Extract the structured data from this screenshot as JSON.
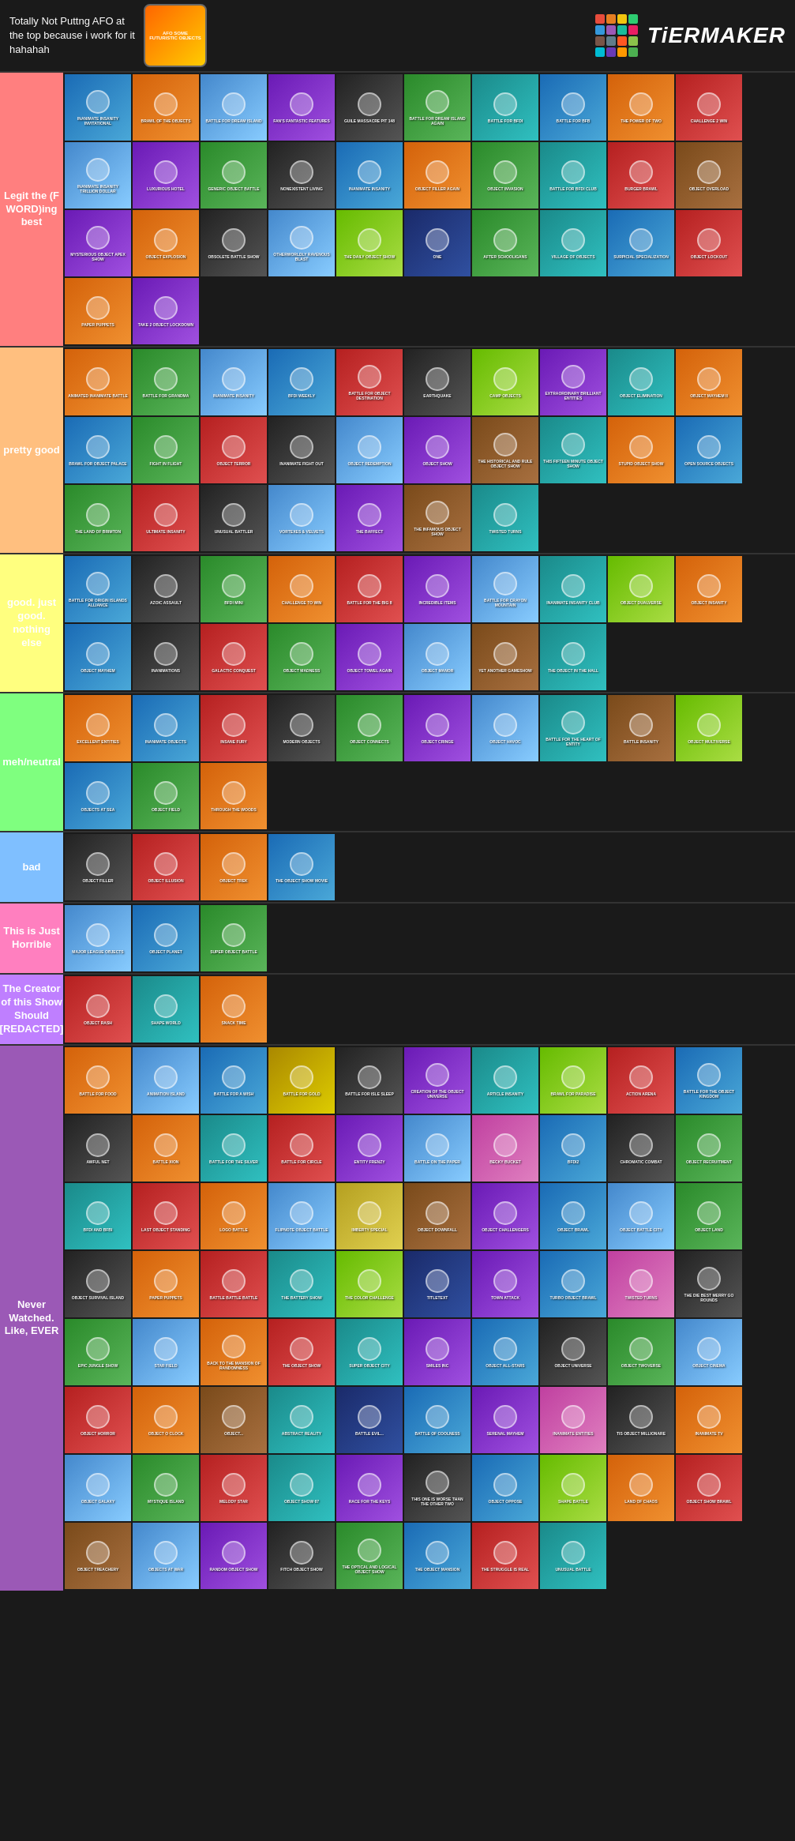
{
  "header": {
    "title": "Totally Not Puttng AFO at the top because i work for it hahahah",
    "logoText": "AFO SOME FUTURISTIC OBJECTS",
    "tiermakerText": "TiERMAKER"
  },
  "tiers": [
    {
      "id": "s",
      "label": "Legit the (F WORD)ing best",
      "color": "#ff7f7f",
      "shows": [
        {
          "name": "INANIMATE INSANITY INVITATIONAL",
          "bg": "bg-blue"
        },
        {
          "name": "BRAWL OF THE OBJECTS",
          "bg": "bg-orange"
        },
        {
          "name": "BATTLE FOR DREAM ISLAND",
          "bg": "bg-sky"
        },
        {
          "name": "FAN'S FANTASTIC FEATURES",
          "bg": "bg-purple"
        },
        {
          "name": "GUILE MASSACRE PIT 148",
          "bg": "bg-dark"
        },
        {
          "name": "BATTLE FOR DREAM ISLAND AGAIN",
          "bg": "bg-green"
        },
        {
          "name": "BATTLE FOR BFDI",
          "bg": "bg-teal"
        },
        {
          "name": "BATTLE FOR BFB",
          "bg": "bg-blue"
        },
        {
          "name": "THE POWER OF TWO",
          "bg": "bg-orange"
        },
        {
          "name": "CHALLENGE 2 WIN",
          "bg": "bg-red"
        },
        {
          "name": "INANIMATE INSANITY TRILLION DOLLAR",
          "bg": "bg-sky"
        },
        {
          "name": "LUXURIOUS HOTEL",
          "bg": "bg-purple"
        },
        {
          "name": "GENERIC OBJECT BATTLE",
          "bg": "bg-green"
        },
        {
          "name": "NONEXISTENT LIVING",
          "bg": "bg-dark"
        },
        {
          "name": "INANIMATE INSANITY",
          "bg": "bg-blue"
        },
        {
          "name": "OBJECT FILLER AGAIN",
          "bg": "bg-orange"
        },
        {
          "name": "OBJECT INVASION",
          "bg": "bg-green"
        },
        {
          "name": "BATTLE FOR BFDI CLUB",
          "bg": "bg-teal"
        },
        {
          "name": "BURGER BRAWL",
          "bg": "bg-red"
        },
        {
          "name": "OBJECT OVERLOAD",
          "bg": "bg-brown"
        },
        {
          "name": "MYSTERIOUS OBJECT APEX SHOW",
          "bg": "bg-purple"
        },
        {
          "name": "OBJECT EXPLOSION",
          "bg": "bg-orange"
        },
        {
          "name": "OBSOLETE BATTLE SHOW",
          "bg": "bg-dark"
        },
        {
          "name": "OTHERWORLDLY RAVENOUS BLAST",
          "bg": "bg-sky"
        },
        {
          "name": "THE DAILY OBJECT SHOW",
          "bg": "bg-lime"
        },
        {
          "name": "ONE",
          "bg": "bg-navy"
        },
        {
          "name": "AFTER SCHOOLIGANS",
          "bg": "bg-green"
        },
        {
          "name": "VILLAGE OF OBJECTS",
          "bg": "bg-teal"
        },
        {
          "name": "SURPICIAL SPECIALIZATION",
          "bg": "bg-blue"
        },
        {
          "name": "OBJECT LOCKOUT",
          "bg": "bg-red"
        },
        {
          "name": "PAPER PUPPETS",
          "bg": "bg-orange"
        },
        {
          "name": "TAKE 2 OBJECT LOCKDOWN",
          "bg": "bg-purple"
        }
      ]
    },
    {
      "id": "a",
      "label": "pretty good",
      "color": "#ffbf7f",
      "shows": [
        {
          "name": "ANIMATED INANIMATE BATTLE",
          "bg": "bg-orange"
        },
        {
          "name": "BATTLE FOR GRANDMA",
          "bg": "bg-green"
        },
        {
          "name": "INANIMATE INSANITY",
          "bg": "bg-sky"
        },
        {
          "name": "BFDI WEEKLY",
          "bg": "bg-blue"
        },
        {
          "name": "BATTLE FOR OBJECT DESTINATION",
          "bg": "bg-red"
        },
        {
          "name": "EARTHQUAKE",
          "bg": "bg-dark"
        },
        {
          "name": "CAMP OBJECTS",
          "bg": "bg-lime"
        },
        {
          "name": "EXTRAORDINARY BRILLIANT ENTITIES",
          "bg": "bg-purple"
        },
        {
          "name": "OBJECT ELIMINATION",
          "bg": "bg-teal"
        },
        {
          "name": "OBJECT MAYHEM II",
          "bg": "bg-orange"
        },
        {
          "name": "BRAWL FOR OBJECT PALACE",
          "bg": "bg-blue"
        },
        {
          "name": "FIGHT IN FLIGHT",
          "bg": "bg-green"
        },
        {
          "name": "OBJECT TERROR",
          "bg": "bg-red"
        },
        {
          "name": "INANIMATE FIGHT OUT",
          "bg": "bg-dark"
        },
        {
          "name": "OBJECT REDEMPTION",
          "bg": "bg-sky"
        },
        {
          "name": "OBJECT SHOW",
          "bg": "bg-purple"
        },
        {
          "name": "THE HISTORICAL AND RULE OBJECT SHOW",
          "bg": "bg-brown"
        },
        {
          "name": "THIS FIFTEEN MINUTE OBJECT SHOW",
          "bg": "bg-teal"
        },
        {
          "name": "STUPID OBJECT SHOW",
          "bg": "bg-orange"
        },
        {
          "name": "OPEN SOURCE OBJECTS",
          "bg": "bg-blue"
        },
        {
          "name": "THE LAND OF BRIMTON",
          "bg": "bg-green"
        },
        {
          "name": "ULTIMATE INSANITY",
          "bg": "bg-red"
        },
        {
          "name": "UNUSUAL BATTLER",
          "bg": "bg-dark"
        },
        {
          "name": "VORTEXES & VELVETS",
          "bg": "bg-sky"
        },
        {
          "name": "THE BAFFECT",
          "bg": "bg-purple"
        },
        {
          "name": "THE INFAMOUS OBJECT SHOW",
          "bg": "bg-brown"
        },
        {
          "name": "TWISTED TURNS",
          "bg": "bg-teal"
        }
      ]
    },
    {
      "id": "b",
      "label": "good. just good. nothing else",
      "color": "#ffff7f",
      "shows": [
        {
          "name": "BATTLE FOR ORIGIN ISLANDS ALLIANCE",
          "bg": "bg-blue"
        },
        {
          "name": "AZOIC ASSAULT",
          "bg": "bg-dark"
        },
        {
          "name": "BFDI MINI",
          "bg": "bg-green"
        },
        {
          "name": "CHALLENGE TO WIN",
          "bg": "bg-orange"
        },
        {
          "name": "BATTLE FOR THE BIG 8",
          "bg": "bg-red"
        },
        {
          "name": "INCREDIBLE ITEMS",
          "bg": "bg-purple"
        },
        {
          "name": "BATTLE FOR CRAYON MOUNTAIN",
          "bg": "bg-sky"
        },
        {
          "name": "INANIMATE INSANITY CLUB",
          "bg": "bg-teal"
        },
        {
          "name": "OBJECT DUALVERSE",
          "bg": "bg-lime"
        },
        {
          "name": "OBJECT INSANITY",
          "bg": "bg-orange"
        },
        {
          "name": "OBJECT MAYHEM",
          "bg": "bg-blue"
        },
        {
          "name": "INANIMATIONS",
          "bg": "bg-dark"
        },
        {
          "name": "GALACTIC CONQUEST",
          "bg": "bg-red"
        },
        {
          "name": "OBJECT MADNESS",
          "bg": "bg-green"
        },
        {
          "name": "OBJECT TOWEL AGAIN",
          "bg": "bg-purple"
        },
        {
          "name": "OBJECT MANOR",
          "bg": "bg-sky"
        },
        {
          "name": "YET ANOTHER GAMESHOW",
          "bg": "bg-brown"
        },
        {
          "name": "THE OBJECT IN THE HALL",
          "bg": "bg-teal"
        }
      ]
    },
    {
      "id": "c",
      "label": "meh/neutral",
      "color": "#7fff7f",
      "shows": [
        {
          "name": "EXCELLENT ENTITIES",
          "bg": "bg-orange"
        },
        {
          "name": "INANIMATE OBJECTS",
          "bg": "bg-blue"
        },
        {
          "name": "INSANE FURY",
          "bg": "bg-red"
        },
        {
          "name": "MODERN OBJECTS",
          "bg": "bg-dark"
        },
        {
          "name": "OBJECT CONNECTS",
          "bg": "bg-green"
        },
        {
          "name": "OBJECT CRINGE",
          "bg": "bg-purple"
        },
        {
          "name": "OBJECT HAVOC",
          "bg": "bg-sky"
        },
        {
          "name": "BATTLE FOR THE HEART OF ENTITY",
          "bg": "bg-teal"
        },
        {
          "name": "BATTLE INSANITY",
          "bg": "bg-brown"
        },
        {
          "name": "OBJECT MULTIVERSE",
          "bg": "bg-lime"
        },
        {
          "name": "OBJECTS AT SEA",
          "bg": "bg-blue"
        },
        {
          "name": "OBJECT FIELD",
          "bg": "bg-green"
        },
        {
          "name": "THROUGH THE WOODS",
          "bg": "bg-orange"
        }
      ]
    },
    {
      "id": "d",
      "label": "bad",
      "color": "#7fbfff",
      "shows": [
        {
          "name": "OBJECT FILLER",
          "bg": "bg-dark"
        },
        {
          "name": "OBJECT ILLUSION",
          "bg": "bg-red"
        },
        {
          "name": "OBJECT TREK",
          "bg": "bg-orange"
        },
        {
          "name": "THE OBJECT SHOW MOVIE",
          "bg": "bg-blue"
        }
      ]
    },
    {
      "id": "e",
      "label": "This is Just Horrible",
      "color": "#ff7fbf",
      "shows": [
        {
          "name": "MAJOR LEAGUE OBJECTS",
          "bg": "bg-sky"
        },
        {
          "name": "OBJECT PLANET",
          "bg": "bg-blue"
        },
        {
          "name": "SUPER OBJECT BATTLE",
          "bg": "bg-green"
        }
      ]
    },
    {
      "id": "f",
      "label": "The Creator of this Show Should [REDACTED]",
      "color": "#bf7fff",
      "shows": [
        {
          "name": "OBJECT RASH",
          "bg": "bg-red"
        },
        {
          "name": "SHAPE WORLD",
          "bg": "bg-teal"
        },
        {
          "name": "SNACK TIME",
          "bg": "bg-orange"
        }
      ]
    },
    {
      "id": "never",
      "label": "Never Watched. Like, EVER",
      "color": "#9b59b6",
      "shows": [
        {
          "name": "BATTLE FOR FOOD",
          "bg": "bg-orange"
        },
        {
          "name": "ANIMATION ISLAND",
          "bg": "bg-sky"
        },
        {
          "name": "BATTLE FOR A WISH",
          "bg": "bg-blue"
        },
        {
          "name": "BATTLE FOR GOLD",
          "bg": "bg-gold"
        },
        {
          "name": "BATTLE FOR ISLE SLEEP",
          "bg": "bg-dark"
        },
        {
          "name": "CREATION OF THE OBJECT UNIVERSE",
          "bg": "bg-purple"
        },
        {
          "name": "ARTICLE INSANITY",
          "bg": "bg-teal"
        },
        {
          "name": "BRAWL FOR PARADISE",
          "bg": "bg-lime"
        },
        {
          "name": "ACTION ARENA",
          "bg": "bg-red"
        },
        {
          "name": "BATTLE FOR THE OBJECT KINGDOM",
          "bg": "bg-blue"
        },
        {
          "name": "AWFUL NET",
          "bg": "bg-dark"
        },
        {
          "name": "BATTLE XION",
          "bg": "bg-orange"
        },
        {
          "name": "BATTLE FOR THE SILVER",
          "bg": "bg-teal"
        },
        {
          "name": "BATTLE FOR CIRCLE",
          "bg": "bg-red"
        },
        {
          "name": "ENTITY FRENZY",
          "bg": "bg-purple"
        },
        {
          "name": "BATTLE ON THE PAPER",
          "bg": "bg-sky"
        },
        {
          "name": "BECKY BUCKET",
          "bg": "bg-pink"
        },
        {
          "name": "BFDI2",
          "bg": "bg-blue"
        },
        {
          "name": "CHROMATIC COMBAT",
          "bg": "bg-dark"
        },
        {
          "name": "OBJECT RECRUITMENT",
          "bg": "bg-green"
        },
        {
          "name": "BFDI AND BFBI",
          "bg": "bg-teal"
        },
        {
          "name": "LAST OBJECT STANDING",
          "bg": "bg-red"
        },
        {
          "name": "LOGO BATTLE",
          "bg": "bg-orange"
        },
        {
          "name": "FLIPNOTE OBJECT BATTLE",
          "bg": "bg-sky"
        },
        {
          "name": "IMBERTY SPECIAL",
          "bg": "bg-yellow"
        },
        {
          "name": "OBJECT DOWNFALL",
          "bg": "bg-brown"
        },
        {
          "name": "OBJECT CHALLENGERS",
          "bg": "bg-purple"
        },
        {
          "name": "OBJECT BRAWL",
          "bg": "bg-blue"
        },
        {
          "name": "OBJECT BATTLE CITY",
          "bg": "bg-sky"
        },
        {
          "name": "OBJECT LAND",
          "bg": "bg-green"
        },
        {
          "name": "OBJECT SURVIVAL ISLAND",
          "bg": "bg-dark"
        },
        {
          "name": "PAPER PUPPETS",
          "bg": "bg-orange"
        },
        {
          "name": "BATTLE BATTLE BATTLE",
          "bg": "bg-red"
        },
        {
          "name": "THE BATTERY SHOW",
          "bg": "bg-teal"
        },
        {
          "name": "THE COLOR CHALLENGE",
          "bg": "bg-lime"
        },
        {
          "name": "TITLETEXT",
          "bg": "bg-navy"
        },
        {
          "name": "TOWN ATTACK",
          "bg": "bg-purple"
        },
        {
          "name": "TURBO OBJECT BRAWL",
          "bg": "bg-blue"
        },
        {
          "name": "TWISTED TURNS",
          "bg": "bg-pink"
        },
        {
          "name": "THE DIE BEST MERRY GO ROUNDS",
          "bg": "bg-dark"
        },
        {
          "name": "EPIC JUNGLE SHOW",
          "bg": "bg-green"
        },
        {
          "name": "STAR FIELD",
          "bg": "bg-sky"
        },
        {
          "name": "BACK TO THE MANSION OF RANDOMNESS",
          "bg": "bg-orange"
        },
        {
          "name": "THE OBJECT SHOW",
          "bg": "bg-red"
        },
        {
          "name": "SUPER OBJECT CITY",
          "bg": "bg-teal"
        },
        {
          "name": "SMILES INC",
          "bg": "bg-purple"
        },
        {
          "name": "OBJECT ALL-STARS",
          "bg": "bg-blue"
        },
        {
          "name": "OBJECT UNIVERSE",
          "bg": "bg-dark"
        },
        {
          "name": "OBJECT TWOVERSE",
          "bg": "bg-green"
        },
        {
          "name": "OBJECT CINEMA",
          "bg": "bg-sky"
        },
        {
          "name": "OBJECT HORROR",
          "bg": "bg-red"
        },
        {
          "name": "OBJECT O CLOCK",
          "bg": "bg-orange"
        },
        {
          "name": "OBJECT...",
          "bg": "bg-brown"
        },
        {
          "name": "ABSTRACT REALITY",
          "bg": "bg-teal"
        },
        {
          "name": "BATTLE EVIL...",
          "bg": "bg-navy"
        },
        {
          "name": "BATTLE OF COOLNESS",
          "bg": "bg-blue"
        },
        {
          "name": "SERENAL MAYHEM",
          "bg": "bg-purple"
        },
        {
          "name": "INANIMATE ENTITIES",
          "bg": "bg-pink"
        },
        {
          "name": "TIS OBJECT MILLIONARE",
          "bg": "bg-dark"
        },
        {
          "name": "INANIMATE TV",
          "bg": "bg-orange"
        },
        {
          "name": "OBJECT GALAXY",
          "bg": "bg-sky"
        },
        {
          "name": "MYSTIQUE ISLAND",
          "bg": "bg-green"
        },
        {
          "name": "MELODY STAR",
          "bg": "bg-red"
        },
        {
          "name": "OBJECT SHOW 67",
          "bg": "bg-teal"
        },
        {
          "name": "RACE FOR THE KEYS",
          "bg": "bg-purple"
        },
        {
          "name": "THIS ONE IS WORSE THAN THE OTHER TWO",
          "bg": "bg-dark"
        },
        {
          "name": "OBJECT OPPOSE",
          "bg": "bg-blue"
        },
        {
          "name": "SHAPE BATTLE",
          "bg": "bg-lime"
        },
        {
          "name": "LAND OF CHAOS",
          "bg": "bg-orange"
        },
        {
          "name": "OBJECT SHOW BRAWL",
          "bg": "bg-red"
        },
        {
          "name": "OBJECT TREACHERY",
          "bg": "bg-brown"
        },
        {
          "name": "OBJECTS AT WAR",
          "bg": "bg-sky"
        },
        {
          "name": "RANDOM OBJECT SHOW",
          "bg": "bg-purple"
        },
        {
          "name": "FITCH OBJECT SHOW",
          "bg": "bg-dark"
        },
        {
          "name": "THE OPTICAL AND LOGICAL OBJECT SHOW",
          "bg": "bg-green"
        },
        {
          "name": "THE OBJECT MANSION",
          "bg": "bg-blue"
        },
        {
          "name": "THE STRUGGLE IS REAL",
          "bg": "bg-red"
        },
        {
          "name": "UNUSUAL BATTLE",
          "bg": "bg-teal"
        }
      ]
    }
  ],
  "gridColors": [
    "#e74c3c",
    "#e67e22",
    "#f1c40f",
    "#2ecc71",
    "#3498db",
    "#9b59b6",
    "#1abc9c",
    "#e91e63",
    "#795548",
    "#607d8b",
    "#ff5722",
    "#8bc34a",
    "#00bcd4",
    "#673ab7",
    "#ff9800",
    "#4caf50"
  ]
}
